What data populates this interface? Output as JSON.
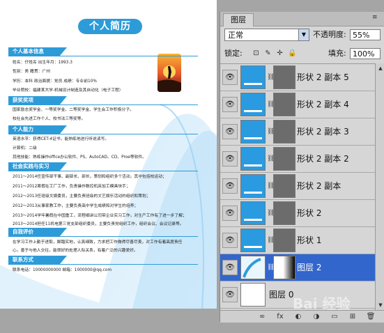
{
  "resume": {
    "title": "个人简历",
    "sections": {
      "basic": "个人基本信息",
      "awards": "获奖奖项",
      "ability": "个人能力",
      "practice": "社会实践与实习",
      "self_eval": "自我评价",
      "contact": "联系方式"
    },
    "basic_lines": [
      "姓名：仔姓名  出生年月：1993.3",
      "性别：男    籍贯：广州",
      "学历：本科  政治面貌：党员  成绩：专业前10%",
      "毕业院校：福建某大学-机械设计制造及其自动化（电子工程）"
    ],
    "award_lines": [
      "国家励志奖学金、一等奖学金、二等奖学金、学生会工作积极分子。",
      "校社会先进工作个人、校书法三等奖等。"
    ],
    "ability_lines": [
      "英语水平：获得CET-4证书，能熟练地进行听说读写。",
      "计算机：二级",
      "其他技能：熟练操作office办公软件、PS、AutoCAD、CD、Proe等软件。"
    ],
    "practice_lines": [
      "2011～2014任宣传部干事、副部长、部长，策划和组织多个活动，其中包括校运动；",
      "2011～2012寒假在工厂工作，负责操作数控机床加工模具块手；",
      "2012～2013任班级文娱委员，主要负责班级的文艺娱乐活动的组织和策划；",
      "2012～2013从事家教工作，主要负责高中学生成绩和对学生的培养；",
      "2013～2014学年暑假在中国重工，流程细讲公司带企业实习工作，对生产工作有了进一步了解；",
      "2013～2014担任11机电第三党支部组织委员，主要负责党组织工作，组织会议、会议记录等。"
    ],
    "self_eval_lines": [
      "在学习工作上勤于进取，脚踏实地，认真细致，力求把工作做得尽善尽美，对工作有着高度责任",
      "心，善于与他人交往，能很好的处理人际关系，有着广泛的兴趣爱好。"
    ],
    "contact_line": "联系电话：10000000000    邮箱：1000000@qq.com"
  },
  "panel": {
    "tab_label": "图层",
    "menu_glyph": "≡",
    "blend_mode": "正常",
    "opacity_label": "不透明度:",
    "opacity_value": "55%",
    "lock_label": "锁定:",
    "fill_label": "填充:",
    "fill_value": "100%",
    "lock_icons": [
      "⊡",
      "✎",
      "✛",
      "🔒"
    ],
    "layers": [
      {
        "name": "形状 2 副本 5",
        "selected": false
      },
      {
        "name": "形状 2 副本 4",
        "selected": false
      },
      {
        "name": "形状 2 副本 3",
        "selected": false
      },
      {
        "name": "形状 2 副本 2",
        "selected": false
      },
      {
        "name": "形状 2 副本",
        "selected": false
      },
      {
        "name": "形状 2",
        "selected": false
      },
      {
        "name": "形状 1",
        "selected": false
      },
      {
        "name": "图层 2",
        "selected": true
      },
      {
        "name": "图层 0",
        "selected": false
      }
    ],
    "footer_icons": [
      "∞",
      "fx",
      "◐",
      "◑",
      "▭",
      "⊞",
      "🗑"
    ]
  },
  "watermark": "Bai 经验"
}
